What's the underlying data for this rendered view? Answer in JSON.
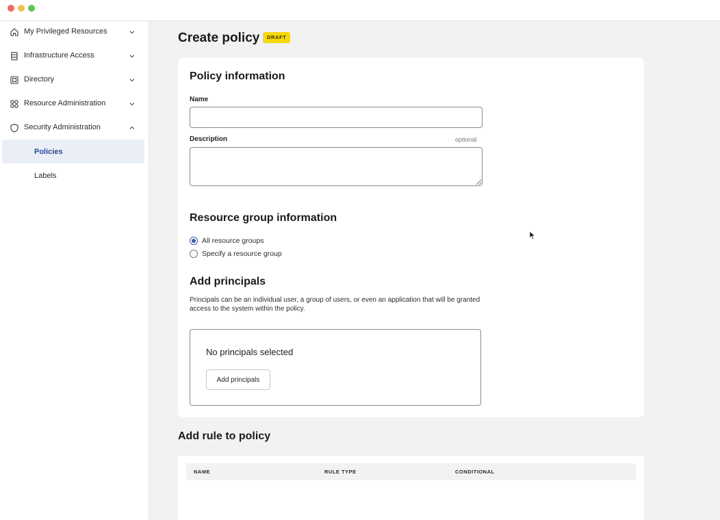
{
  "window": {
    "controls": [
      "close",
      "minimize",
      "maximize"
    ]
  },
  "sidebar": {
    "items": [
      {
        "label": "My Privileged Resources",
        "icon": "home-icon",
        "expanded": false
      },
      {
        "label": "Infrastructure Access",
        "icon": "server-icon",
        "expanded": false
      },
      {
        "label": "Directory",
        "icon": "directory-icon",
        "expanded": false
      },
      {
        "label": "Resource Administration",
        "icon": "grid-icon",
        "expanded": false
      },
      {
        "label": "Security Administration",
        "icon": "shield-icon",
        "expanded": true
      }
    ],
    "subitems": [
      {
        "label": "Policies",
        "active": true
      },
      {
        "label": "Labels",
        "active": false
      }
    ]
  },
  "page": {
    "title": "Create policy",
    "badge": "DRAFT"
  },
  "policy_info": {
    "title": "Policy information",
    "name_label": "Name",
    "name_value": "",
    "description_label": "Description",
    "description_optional": "optional",
    "description_value": ""
  },
  "resource_group": {
    "title": "Resource group information",
    "options": [
      {
        "label": "All resource groups",
        "checked": true
      },
      {
        "label": "Specify a resource group",
        "checked": false
      }
    ]
  },
  "principals": {
    "title": "Add principals",
    "description": "Principals can be an individual user, a group of users, or even an application that will be granted access to the system within the policy.",
    "empty_text": "No principals selected",
    "button_label": "Add principals"
  },
  "rules": {
    "title": "Add rule to policy",
    "columns": [
      "NAME",
      "RULE TYPE",
      "CONDITIONAL"
    ]
  },
  "colors": {
    "accent": "#3b5ba8",
    "badge": "#f5d90a",
    "active_bg": "#eaeef7"
  }
}
